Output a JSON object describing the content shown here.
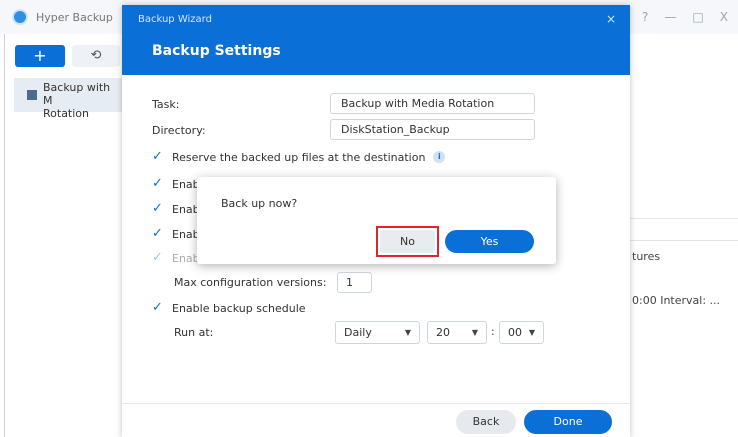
{
  "app": {
    "title": "Hyper Backup",
    "window_controls": [
      "?",
      "—",
      "□",
      "X"
    ],
    "toolbar": {
      "add_label": "+",
      "history_label": "⟲"
    },
    "tasks": [
      {
        "label": "Backup with Media Rotation",
        "label_line1": "Backup with M",
        "label_line2": "Rotation"
      }
    ],
    "right_panel": {
      "text1": "tures",
      "text2": "0:00 Interval: ..."
    }
  },
  "wizard": {
    "window_title": "Backup Wizard",
    "close_label": "×",
    "heading": "Backup Settings",
    "task_label": "Task:",
    "task_value": "Backup with Media Rotation",
    "directory_label": "Directory:",
    "directory_value": "DiskStation_Backup",
    "checkboxes": [
      {
        "label": "Reserve the backed up files at the destination",
        "checked": true,
        "info": true
      },
      {
        "label": "Enab",
        "checked": true
      },
      {
        "label": "Enab",
        "checked": true
      },
      {
        "label": "Enab",
        "checked": true
      },
      {
        "label": "Enab",
        "checked": true,
        "disabled": true
      }
    ],
    "max_versions_label": "Max configuration versions:",
    "max_versions_value": "1",
    "schedule_label": "Enable backup schedule",
    "run_at_label": "Run at:",
    "run_at_frequency": "Daily",
    "run_at_hour": "20",
    "run_at_minute": "00",
    "back_label": "Back",
    "done_label": "Done"
  },
  "dialog": {
    "message": "Back up now?",
    "no_label": "No",
    "yes_label": "Yes"
  },
  "colors": {
    "accent": "#0a70d8",
    "highlight": "#e0242b"
  }
}
